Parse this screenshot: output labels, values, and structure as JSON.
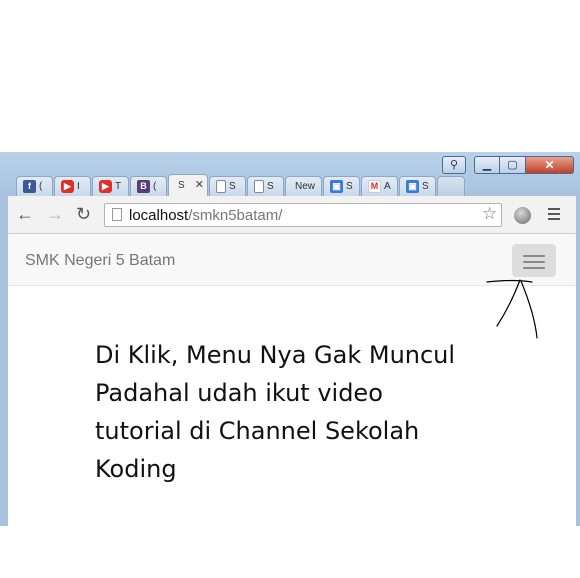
{
  "window_controls": {
    "user_icon": "user-icon",
    "minimize_icon": "minimize-icon",
    "maximize_icon": "maximize-icon",
    "close_icon": "close-icon",
    "minimize_glyph": "▁",
    "maximize_glyph": "▢",
    "close_glyph": "✕",
    "user_glyph": "⚲"
  },
  "tabs": [
    {
      "icon": "facebook-icon",
      "glyph": "f",
      "title": "("
    },
    {
      "icon": "youtube-icon",
      "glyph": "▶",
      "title": "I"
    },
    {
      "icon": "youtube-icon",
      "glyph": "▶",
      "title": "T"
    },
    {
      "icon": "bootstrap-icon",
      "glyph": "B",
      "title": "("
    },
    {
      "icon": "page-icon",
      "glyph": "",
      "title": "S",
      "active": true,
      "close": "✕"
    },
    {
      "icon": "page-icon",
      "glyph": "",
      "title": "S"
    },
    {
      "icon": "page-icon",
      "glyph": "",
      "title": "S"
    },
    {
      "icon": "none",
      "glyph": "",
      "title": "New"
    },
    {
      "icon": "app-icon",
      "glyph": "▣",
      "title": "S"
    },
    {
      "icon": "gmail-icon",
      "glyph": "M",
      "title": "A"
    },
    {
      "icon": "app-icon",
      "glyph": "▣",
      "title": "S"
    }
  ],
  "toolbar": {
    "back_glyph": "←",
    "forward_glyph": "→",
    "reload_glyph": "↻",
    "star_glyph": "☆",
    "url_host": "localhost",
    "url_path": "/smkn5batam/"
  },
  "navbar": {
    "brand": "SMK Negeri 5 Batam"
  },
  "annotation": {
    "text": "Di Klik, Menu Nya Gak Muncul\nPadahal udah ikut video\ntutorial di Channel Sekolah\nKoding"
  }
}
